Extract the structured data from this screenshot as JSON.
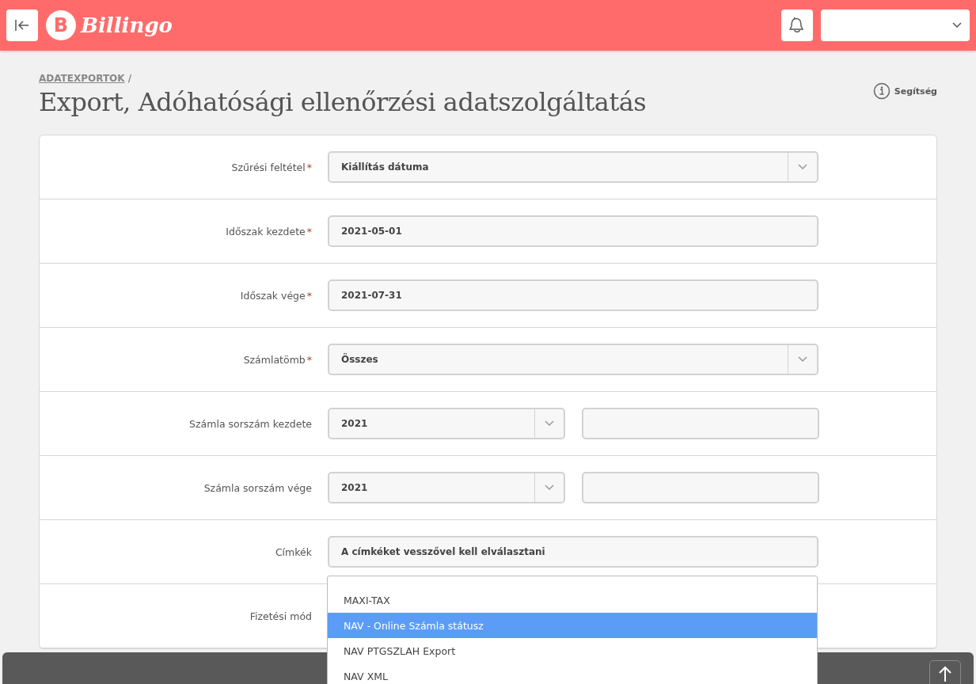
{
  "header": {
    "logo": {
      "mark": "B",
      "name": "Billingo"
    }
  },
  "breadcrumb": {
    "link": "ADATEXPORTOK",
    "separator": "/"
  },
  "page_title": "Export, Adóhatósági ellenőrzési adatszolgáltatás",
  "help": "Segítség",
  "form": {
    "required_mark": "*",
    "rows": [
      {
        "label": "Szűrési feltétel",
        "required": true,
        "kind": "select",
        "value": "Kiállítás dátuma"
      },
      {
        "label": "Időszak kezdete",
        "required": true,
        "kind": "input",
        "value": "2021-05-01"
      },
      {
        "label": "Időszak vége",
        "required": true,
        "kind": "input",
        "value": "2021-07-31"
      },
      {
        "label": "Számlatömb",
        "required": true,
        "kind": "select",
        "value": "Összes"
      },
      {
        "label": "Számla sorszám kezdete",
        "required": false,
        "kind": "split",
        "value": "2021"
      },
      {
        "label": "Számla sorszám vége",
        "required": false,
        "kind": "split",
        "value": "2021"
      },
      {
        "label": "Címkék",
        "required": false,
        "kind": "input",
        "value": "A címkéket vesszővel kell elválasztani"
      },
      {
        "label": "Fizetési mód",
        "required": false,
        "kind": "hidden"
      }
    ]
  },
  "dropdown": {
    "options": [
      {
        "label": "MAXI-TAX",
        "selected": false
      },
      {
        "label": "NAV - Online Számla státusz",
        "selected": true
      },
      {
        "label": "NAV PTGSZLAH Export",
        "selected": false
      },
      {
        "label": "NAV XML",
        "selected": false
      }
    ]
  }
}
